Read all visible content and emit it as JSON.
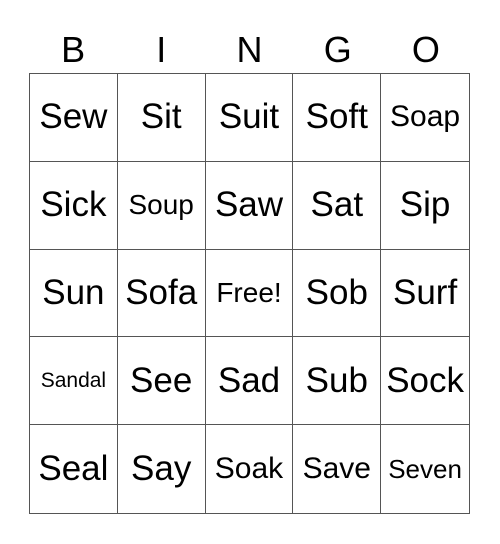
{
  "header": [
    "B",
    "I",
    "N",
    "G",
    "O"
  ],
  "cells": [
    [
      "Sew",
      "Sit",
      "Suit",
      "Soft",
      "Soap"
    ],
    [
      "Sick",
      "Soup",
      "Saw",
      "Sat",
      "Sip"
    ],
    [
      "Sun",
      "Sofa",
      "Free!",
      "Sob",
      "Surf"
    ],
    [
      "Sandal",
      "See",
      "Sad",
      "Sub",
      "Sock"
    ],
    [
      "Seal",
      "Say",
      "Soak",
      "Save",
      "Seven"
    ]
  ]
}
